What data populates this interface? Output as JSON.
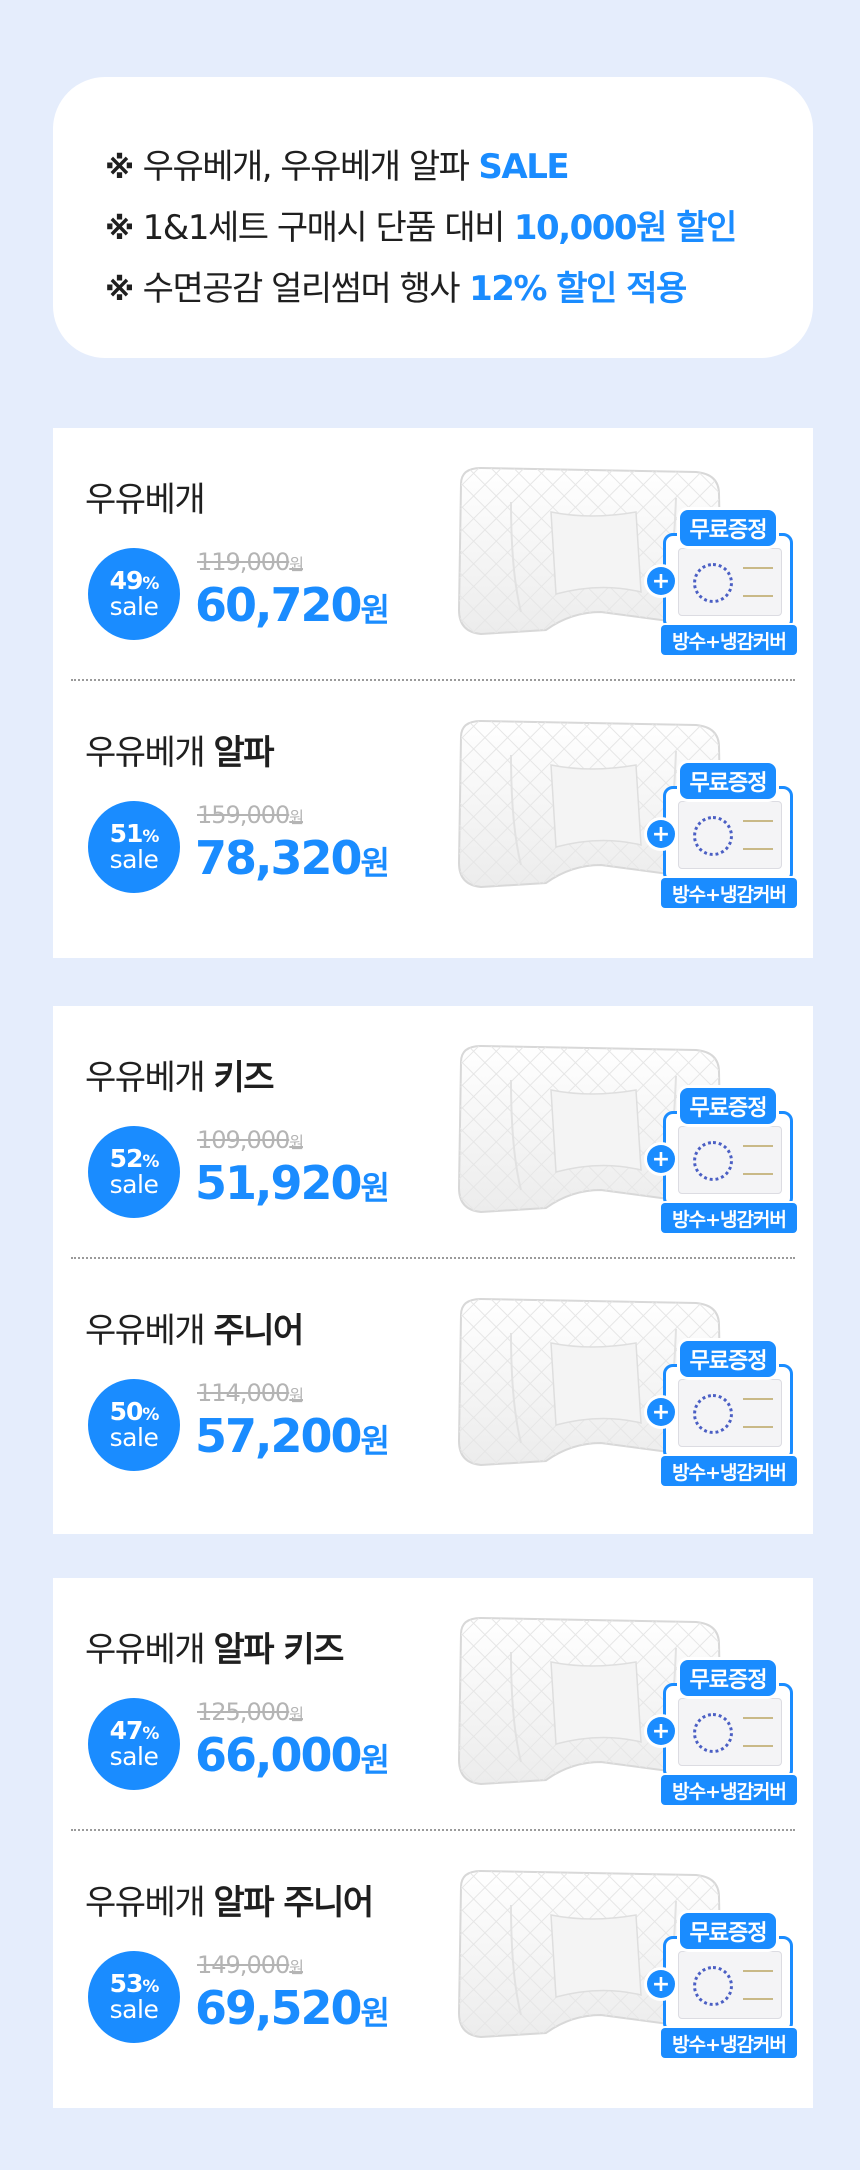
{
  "notice": {
    "mark": "※",
    "lines": [
      {
        "text": "우유베개, 우유베개 알파",
        "highlight": "SALE"
      },
      {
        "text": "1&1세트 구매시 단품 대비",
        "highlight": "10,000원 할인"
      },
      {
        "text": "수면공감 얼리썸머 행사",
        "highlight": "12% 할인 적용"
      }
    ]
  },
  "gift": {
    "tag": "무료증정",
    "plus": "+",
    "label": "방수+냉감커버"
  },
  "units": {
    "percent": "%",
    "sale": "sale",
    "won": "원"
  },
  "products": [
    {
      "name_plain": "우유베개",
      "name_bold": "",
      "discount": "49",
      "original": "119,000",
      "price": "60,720"
    },
    {
      "name_plain": "우유베개 ",
      "name_bold": "알파",
      "discount": "51",
      "original": "159,000",
      "price": "78,320"
    },
    {
      "name_plain": "우유베개 ",
      "name_bold": "키즈",
      "discount": "52",
      "original": "109,000",
      "price": "51,920"
    },
    {
      "name_plain": "우유베개 ",
      "name_bold": "주니어",
      "discount": "50",
      "original": "114,000",
      "price": "57,200"
    },
    {
      "name_plain": "우유베개 ",
      "name_bold": "알파 키즈",
      "discount": "47",
      "original": "125,000",
      "price": "66,000"
    },
    {
      "name_plain": "우유베개 ",
      "name_bold": "알파 주니어",
      "discount": "53",
      "original": "149,000",
      "price": "69,520"
    }
  ],
  "colors": {
    "accent": "#1a8cff",
    "background": "#e5edfc",
    "strike": "#b4b4b4"
  }
}
